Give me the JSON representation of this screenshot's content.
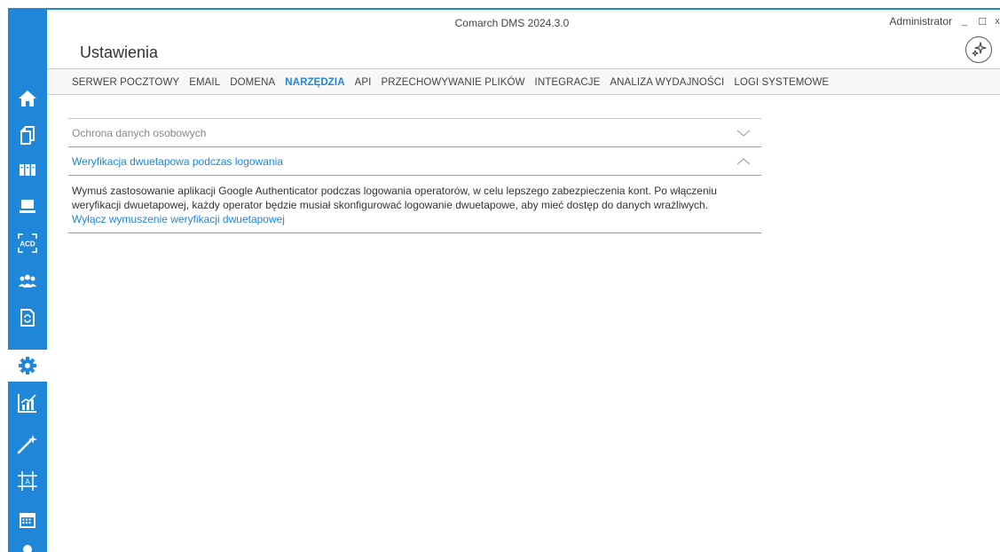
{
  "window": {
    "app_title": "Comarch DMS 2024.3.0",
    "user": "Administrator",
    "minimize_label": "_",
    "maximize_label": "☐",
    "close_label": "x"
  },
  "page": {
    "title": "Ustawienia"
  },
  "tabs": [
    {
      "label": "SERWER POCZTOWY",
      "active": false
    },
    {
      "label": "EMAIL",
      "active": false
    },
    {
      "label": "DOMENA",
      "active": false
    },
    {
      "label": "NARZĘDZIA",
      "active": true
    },
    {
      "label": "API",
      "active": false
    },
    {
      "label": "PRZECHOWYWANIE PLIKÓW",
      "active": false
    },
    {
      "label": "INTEGRACJE",
      "active": false
    },
    {
      "label": "ANALIZA WYDAJNOŚCI",
      "active": false
    },
    {
      "label": "LOGI SYSTEMOWE",
      "active": false
    }
  ],
  "sections": [
    {
      "title": "Ochrona danych osobowych",
      "expanded": false
    },
    {
      "title": "Weryfikacja dwuetapowa podczas logowania",
      "expanded": true,
      "description": "Wymuś zastosowanie aplikacji Google Authenticator podczas logowania operatorów, w celu lepszego zabezpieczenia kont. Po włączeniu weryfikacji dwuetapowej, każdy operator będzie musiał skonfigurować logowanie dwuetapowe, aby mieć dostęp do danych wrażliwych.",
      "action_link": "Wyłącz wymuszenie weryfikacji dwuetapowej"
    }
  ],
  "sidebar": {
    "items": [
      {
        "icon": "home-icon"
      },
      {
        "icon": "documents-icon"
      },
      {
        "icon": "archive-icon"
      },
      {
        "icon": "workstation-icon"
      },
      {
        "icon": "acd-icon"
      },
      {
        "icon": "users-icon"
      },
      {
        "icon": "document-sync-icon"
      },
      {
        "icon": "settings-gear-icon",
        "active": true
      },
      {
        "icon": "analytics-chart-icon"
      },
      {
        "icon": "magic-wand-icon"
      },
      {
        "icon": "template-designer-icon"
      },
      {
        "icon": "calendar-icon"
      },
      {
        "icon": "user-icon"
      }
    ]
  },
  "colors": {
    "accent": "#1f86d8",
    "sidebar_bg": "#1f86d8",
    "text": "#333333",
    "muted": "#888888",
    "separator": "#c8c8c8"
  }
}
